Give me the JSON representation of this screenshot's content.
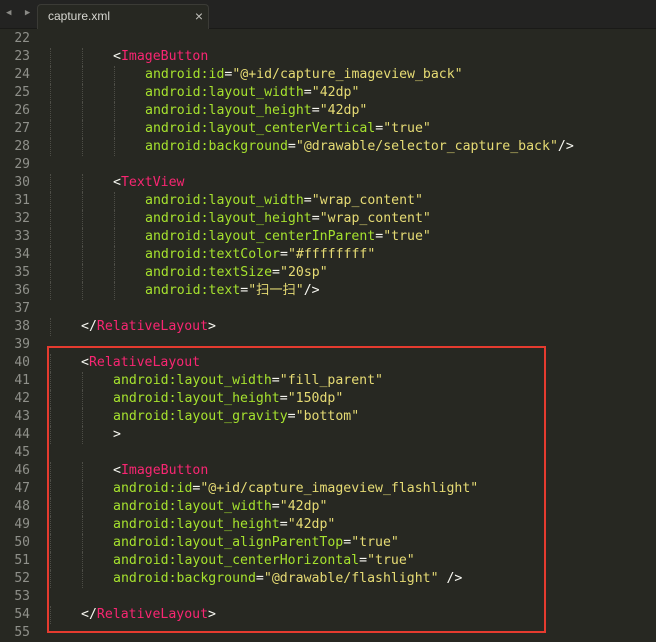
{
  "tabbar": {
    "nav": "◀ ▶",
    "tab_label": "capture.xml",
    "close_glyph": "×"
  },
  "editor": {
    "colors": {
      "background": "#272822",
      "tag": "#f92672",
      "attribute": "#a6e22e",
      "string": "#e6db74",
      "punctuation": "#f8f8f2",
      "line_number": "#8f908a",
      "highlight_border": "#e53b2f"
    },
    "lines": [
      {
        "n": "22",
        "indent": 0,
        "tokens": []
      },
      {
        "n": "23",
        "indent": 8,
        "tokens": [
          [
            "p",
            "<"
          ],
          [
            "t",
            "ImageButton"
          ]
        ]
      },
      {
        "n": "24",
        "indent": 12,
        "tokens": [
          [
            "a",
            "android:id"
          ],
          [
            "p",
            "="
          ],
          [
            "s",
            "\"@+id/capture_imageview_back\""
          ]
        ]
      },
      {
        "n": "25",
        "indent": 12,
        "tokens": [
          [
            "a",
            "android:layout_width"
          ],
          [
            "p",
            "="
          ],
          [
            "s",
            "\"42dp\""
          ]
        ]
      },
      {
        "n": "26",
        "indent": 12,
        "tokens": [
          [
            "a",
            "android:layout_height"
          ],
          [
            "p",
            "="
          ],
          [
            "s",
            "\"42dp\""
          ]
        ]
      },
      {
        "n": "27",
        "indent": 12,
        "tokens": [
          [
            "a",
            "android:layout_centerVertical"
          ],
          [
            "p",
            "="
          ],
          [
            "s",
            "\"true\""
          ]
        ]
      },
      {
        "n": "28",
        "indent": 12,
        "tokens": [
          [
            "a",
            "android:background"
          ],
          [
            "p",
            "="
          ],
          [
            "s",
            "\"@drawable/selector_capture_back\""
          ],
          [
            "p",
            "/>"
          ]
        ]
      },
      {
        "n": "29",
        "indent": 0,
        "tokens": []
      },
      {
        "n": "30",
        "indent": 8,
        "tokens": [
          [
            "p",
            "<"
          ],
          [
            "t",
            "TextView"
          ]
        ]
      },
      {
        "n": "31",
        "indent": 12,
        "tokens": [
          [
            "a",
            "android:layout_width"
          ],
          [
            "p",
            "="
          ],
          [
            "s",
            "\"wrap_content\""
          ]
        ]
      },
      {
        "n": "32",
        "indent": 12,
        "tokens": [
          [
            "a",
            "android:layout_height"
          ],
          [
            "p",
            "="
          ],
          [
            "s",
            "\"wrap_content\""
          ]
        ]
      },
      {
        "n": "33",
        "indent": 12,
        "tokens": [
          [
            "a",
            "android:layout_centerInParent"
          ],
          [
            "p",
            "="
          ],
          [
            "s",
            "\"true\""
          ]
        ]
      },
      {
        "n": "34",
        "indent": 12,
        "tokens": [
          [
            "a",
            "android:textColor"
          ],
          [
            "p",
            "="
          ],
          [
            "s",
            "\"#ffffffff\""
          ]
        ]
      },
      {
        "n": "35",
        "indent": 12,
        "tokens": [
          [
            "a",
            "android:textSize"
          ],
          [
            "p",
            "="
          ],
          [
            "s",
            "\"20sp\""
          ]
        ]
      },
      {
        "n": "36",
        "indent": 12,
        "tokens": [
          [
            "a",
            "android:text"
          ],
          [
            "p",
            "="
          ],
          [
            "s",
            "\"扫一扫\""
          ],
          [
            "p",
            "/>"
          ]
        ]
      },
      {
        "n": "37",
        "indent": 0,
        "tokens": []
      },
      {
        "n": "38",
        "indent": 4,
        "tokens": [
          [
            "p",
            "</"
          ],
          [
            "t",
            "RelativeLayout"
          ],
          [
            "p",
            ">"
          ]
        ]
      },
      {
        "n": "39",
        "indent": 0,
        "tokens": []
      },
      {
        "n": "40",
        "indent": 4,
        "tokens": [
          [
            "p",
            "<"
          ],
          [
            "t",
            "RelativeLayout"
          ]
        ]
      },
      {
        "n": "41",
        "indent": 8,
        "tokens": [
          [
            "a",
            "android:layout_width"
          ],
          [
            "p",
            "="
          ],
          [
            "s",
            "\"fill_parent\""
          ]
        ]
      },
      {
        "n": "42",
        "indent": 8,
        "tokens": [
          [
            "a",
            "android:layout_height"
          ],
          [
            "p",
            "="
          ],
          [
            "s",
            "\"150dp\""
          ]
        ]
      },
      {
        "n": "43",
        "indent": 8,
        "tokens": [
          [
            "a",
            "android:layout_gravity"
          ],
          [
            "p",
            "="
          ],
          [
            "s",
            "\"bottom\""
          ]
        ]
      },
      {
        "n": "44",
        "indent": 8,
        "tokens": [
          [
            "p",
            ">"
          ]
        ]
      },
      {
        "n": "45",
        "indent": 0,
        "tokens": []
      },
      {
        "n": "46",
        "indent": 8,
        "tokens": [
          [
            "p",
            "<"
          ],
          [
            "t",
            "ImageButton"
          ]
        ]
      },
      {
        "n": "47",
        "indent": 8,
        "tokens": [
          [
            "a",
            "android:id"
          ],
          [
            "p",
            "="
          ],
          [
            "s",
            "\"@+id/capture_imageview_flashlight\""
          ]
        ]
      },
      {
        "n": "48",
        "indent": 8,
        "tokens": [
          [
            "a",
            "android:layout_width"
          ],
          [
            "p",
            "="
          ],
          [
            "s",
            "\"42dp\""
          ]
        ]
      },
      {
        "n": "49",
        "indent": 8,
        "tokens": [
          [
            "a",
            "android:layout_height"
          ],
          [
            "p",
            "="
          ],
          [
            "s",
            "\"42dp\""
          ]
        ]
      },
      {
        "n": "50",
        "indent": 8,
        "tokens": [
          [
            "a",
            "android:layout_alignParentTop"
          ],
          [
            "p",
            "="
          ],
          [
            "s",
            "\"true\""
          ]
        ]
      },
      {
        "n": "51",
        "indent": 8,
        "tokens": [
          [
            "a",
            "android:layout_centerHorizontal"
          ],
          [
            "p",
            "="
          ],
          [
            "s",
            "\"true\""
          ]
        ]
      },
      {
        "n": "52",
        "indent": 8,
        "tokens": [
          [
            "a",
            "android:background"
          ],
          [
            "p",
            "="
          ],
          [
            "s",
            "\"@drawable/flashlight\""
          ],
          [
            "p",
            " />"
          ]
        ]
      },
      {
        "n": "53",
        "indent": 0,
        "tokens": []
      },
      {
        "n": "54",
        "indent": 4,
        "tokens": [
          [
            "p",
            "</"
          ],
          [
            "t",
            "RelativeLayout"
          ],
          [
            "p",
            ">"
          ]
        ]
      },
      {
        "n": "55",
        "indent": 0,
        "tokens": []
      }
    ]
  }
}
